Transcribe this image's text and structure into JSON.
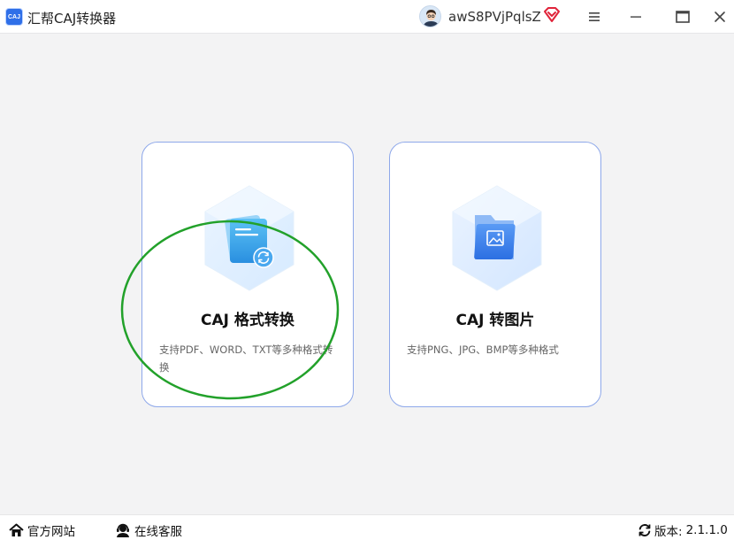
{
  "window": {
    "app_logo_text": "CAJ",
    "title": "汇帮CAJ转换器",
    "username": "awS8PVjPqlsZ"
  },
  "cards": [
    {
      "title": "CAJ 格式转换",
      "description": "支持PDF、WORD、TXT等多种格式转换"
    },
    {
      "title": "CAJ 转图片",
      "description": "支持PNG、JPG、BMP等多种格式"
    }
  ],
  "footer": {
    "official_site": "官方网站",
    "online_service": "在线客服",
    "version_label": "版本:",
    "version_number": "2.1.1.0"
  },
  "colors": {
    "accent": "#2f6fe8",
    "card_border": "#8ea8ea",
    "highlight_ring": "#22a12a",
    "vip": "#e0243a",
    "background": "#f3f3f4"
  },
  "icons": {
    "app": "caj-logo-icon",
    "vip": "vip-diamond-icon",
    "menu": "hamburger-menu-icon",
    "minimize": "minimize-icon",
    "maximize": "maximize-icon",
    "close": "close-icon",
    "card1": "document-convert-icon",
    "card2": "image-folder-icon",
    "home": "home-icon",
    "service": "headset-icon",
    "version": "refresh-icon"
  }
}
